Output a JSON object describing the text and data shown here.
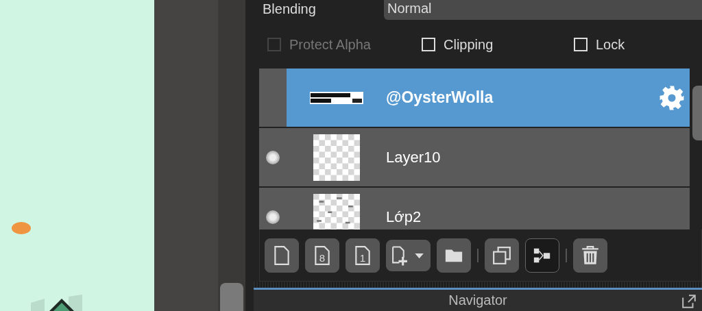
{
  "blending": {
    "label": "Blending",
    "value": "Normal"
  },
  "options": [
    {
      "label": "Protect Alpha",
      "checked": false,
      "disabled": true
    },
    {
      "label": "Clipping",
      "checked": false,
      "disabled": false
    },
    {
      "label": "Lock",
      "checked": false,
      "disabled": false
    }
  ],
  "layers": [
    {
      "name": "@OysterWolla",
      "selected": true,
      "visible": false,
      "kind": "text"
    },
    {
      "name": "Layer10",
      "selected": false,
      "visible": true,
      "kind": "empty"
    },
    {
      "name": "Lớp2",
      "selected": false,
      "visible": true,
      "kind": "sketch"
    }
  ],
  "toolbar": [
    {
      "kind": "file",
      "selected": false
    },
    {
      "kind": "file-digit",
      "label": "8",
      "selected": false
    },
    {
      "kind": "file-digit",
      "label": "1",
      "selected": false
    },
    {
      "kind": "add-menu",
      "selected": false
    },
    {
      "kind": "folder",
      "selected": false
    },
    {
      "kind": "separator"
    },
    {
      "kind": "copy",
      "selected": false
    },
    {
      "kind": "merge",
      "selected": true
    },
    {
      "kind": "separator"
    },
    {
      "kind": "delete",
      "selected": false
    }
  ],
  "navigator": {
    "title": "Navigator"
  }
}
